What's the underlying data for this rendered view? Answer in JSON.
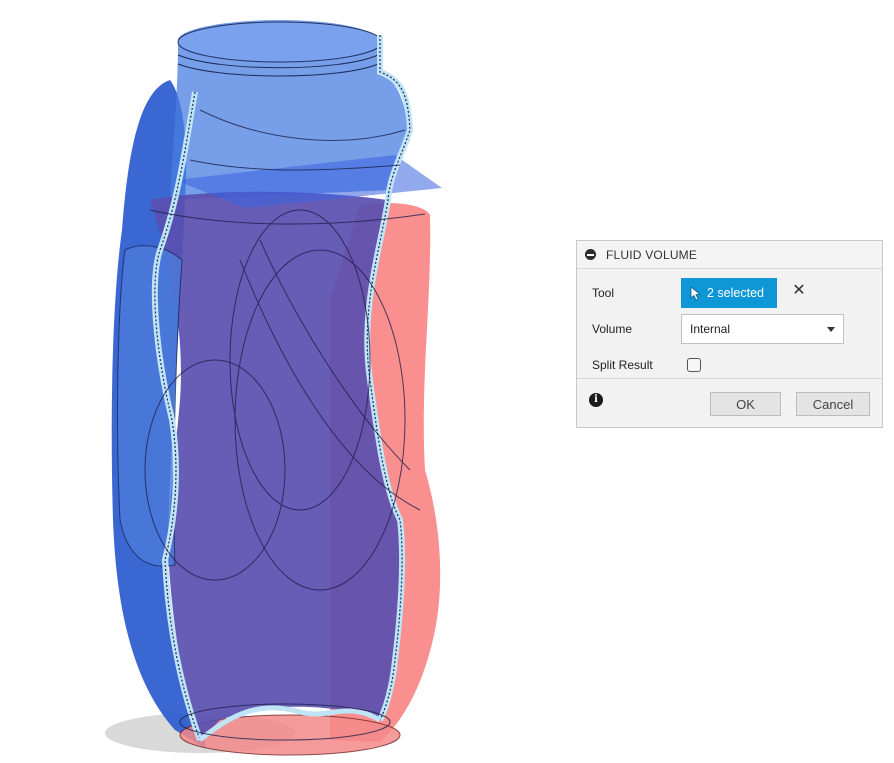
{
  "dialog": {
    "title": "FLUID VOLUME",
    "tool_label": "Tool",
    "tool_value": "2 selected",
    "volume_label": "Volume",
    "volume_value": "Internal",
    "split_label": "Split Result",
    "split_checked": false,
    "info_glyph": "i",
    "ok_label": "OK",
    "cancel_label": "Cancel",
    "clear_glyph": "✕"
  },
  "model": {
    "blue_color": "#3a72d8",
    "red_color": "#f26a6a",
    "purple_color": "#5a4fb0",
    "tool_button_color": "#0f96d6"
  },
  "icons": {
    "collapse": "collapse-icon",
    "cursor": "cursor-arrow-icon",
    "clear": "close-icon",
    "dropdown": "chevron-down-icon",
    "info": "info-icon"
  }
}
